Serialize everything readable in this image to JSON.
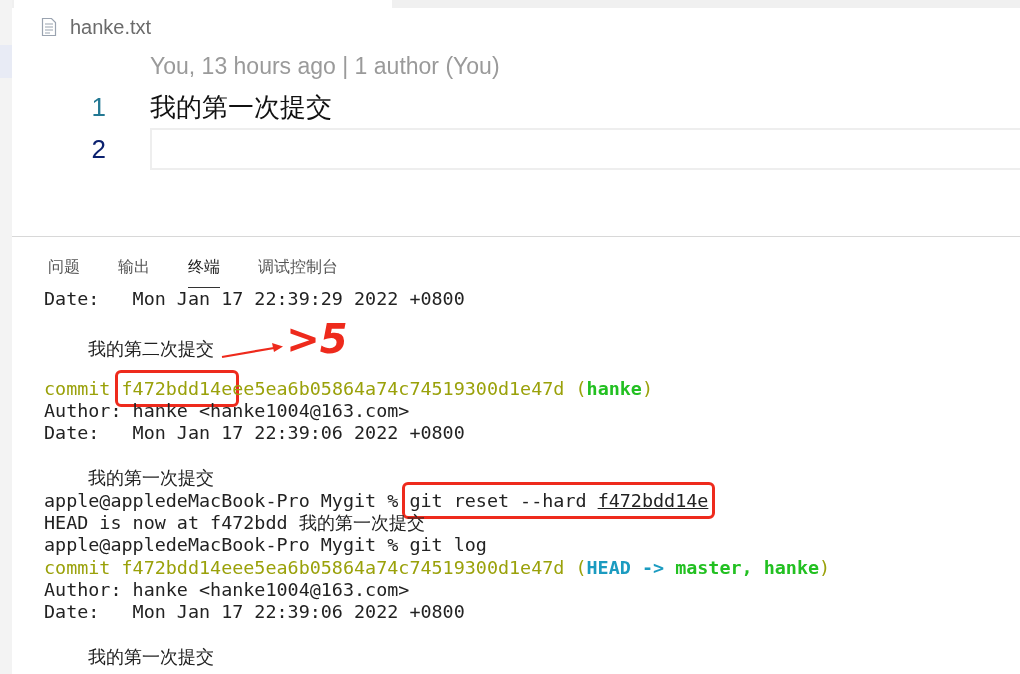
{
  "editor": {
    "filename": "hanke.txt",
    "blame": "You, 13 hours ago | 1 author (You)",
    "lines": [
      {
        "number": "1",
        "text": "我的第一次提交",
        "current": false
      },
      {
        "number": "2",
        "current": true
      }
    ]
  },
  "panel": {
    "tabs": [
      {
        "label": "问题",
        "selected": false
      },
      {
        "label": "输出",
        "selected": false
      },
      {
        "label": "终端",
        "selected": true
      },
      {
        "label": "调试控制台",
        "selected": false
      }
    ]
  },
  "terminal": {
    "lines": [
      {
        "kind": "text",
        "segments": [
          {
            "kind": "plain",
            "text": "Date:   Mon Jan 17 22:39:29 2022 +0800"
          }
        ]
      },
      {
        "kind": "blank"
      },
      {
        "kind": "text",
        "segments": [
          {
            "kind": "plain",
            "text": "    我的第二次提交"
          }
        ],
        "note": ">5"
      },
      {
        "kind": "blank"
      },
      {
        "kind": "text",
        "segments": [
          {
            "kind": "hash",
            "text": "commit "
          },
          {
            "kind": "hash",
            "text": "f472bdd14e",
            "boxed": true
          },
          {
            "kind": "hash",
            "text": "ee5ea6b05864a74c74519300d1e47d ("
          },
          {
            "kind": "branch",
            "text": "hanke"
          },
          {
            "kind": "hash",
            "text": ")"
          }
        ]
      },
      {
        "kind": "text",
        "segments": [
          {
            "kind": "plain",
            "text": "Author: hanke <hanke1004@163.com>"
          }
        ]
      },
      {
        "kind": "text",
        "segments": [
          {
            "kind": "plain",
            "text": "Date:   Mon Jan 17 22:39:06 2022 +0800"
          }
        ]
      },
      {
        "kind": "blank"
      },
      {
        "kind": "text",
        "segments": [
          {
            "kind": "plain",
            "text": "    我的第一次提交"
          }
        ]
      },
      {
        "kind": "text",
        "segments": [
          {
            "kind": "plain",
            "text": "apple@appledeMacBook-Pro Mygit % "
          },
          {
            "kind": "plain",
            "boxed": true,
            "parts": [
              {
                "text": "git reset --hard "
              },
              {
                "text": "f472bdd14e",
                "underline": true
              }
            ]
          }
        ]
      },
      {
        "kind": "text",
        "segments": [
          {
            "kind": "plain",
            "text": "HEAD is now at f472bdd 我的第一次提交"
          }
        ]
      },
      {
        "kind": "text",
        "segments": [
          {
            "kind": "plain",
            "text": "apple@appledeMacBook-Pro Mygit % git log"
          }
        ]
      },
      {
        "kind": "text",
        "segments": [
          {
            "kind": "hash",
            "text": "commit f472bdd14eee5ea6b05864a74c74519300d1e47d ("
          },
          {
            "kind": "head",
            "text": "HEAD -> "
          },
          {
            "kind": "branch",
            "text": "master, hanke"
          },
          {
            "kind": "hash",
            "text": ")"
          }
        ]
      },
      {
        "kind": "text",
        "segments": [
          {
            "kind": "plain",
            "text": "Author: hanke <hanke1004@163.com>"
          }
        ]
      },
      {
        "kind": "text",
        "segments": [
          {
            "kind": "plain",
            "text": "Date:   Mon Jan 17 22:39:06 2022 +0800"
          }
        ]
      },
      {
        "kind": "blank"
      },
      {
        "kind": "text",
        "segments": [
          {
            "kind": "plain",
            "text": "    我的第一次提交"
          }
        ]
      }
    ]
  }
}
